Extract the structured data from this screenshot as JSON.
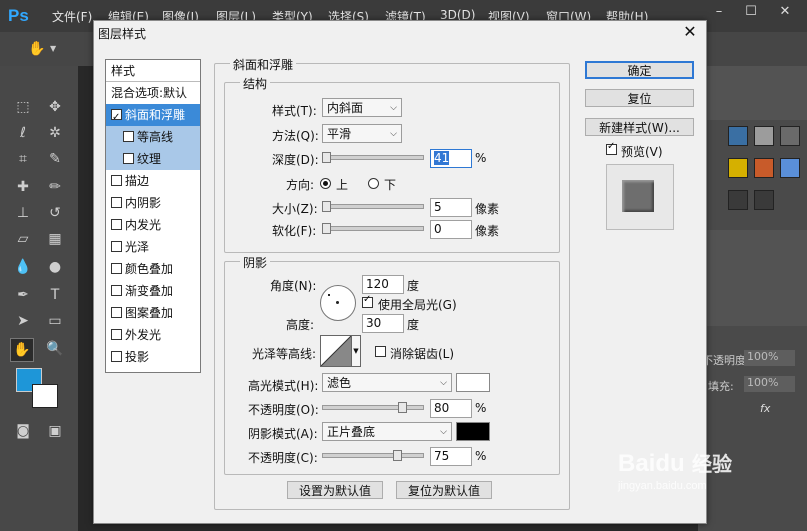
{
  "app": {
    "logo": "Ps",
    "menus": [
      "文件(F)",
      "编辑(E)",
      "图像(I)",
      "图层(L)",
      "类型(Y)",
      "选择(S)",
      "滤镜(T)",
      "3D(D)",
      "视图(V)",
      "窗口(W)",
      "帮助(H)"
    ],
    "right_panel": {
      "opacity_label": "不透明度:",
      "opacity_value": "100%",
      "fill_label": "填充:",
      "fill_value": "100%",
      "fx": "fx"
    }
  },
  "dialog": {
    "title": "图层样式",
    "close": "✕",
    "sidebar": {
      "header": "样式",
      "blend": "混合选项:默认",
      "items": [
        {
          "label": "斜面和浮雕",
          "checked": true,
          "selected": true,
          "sub": false
        },
        {
          "label": "等高线",
          "checked": false,
          "selected": false,
          "sub": true
        },
        {
          "label": "纹理",
          "checked": false,
          "selected": false,
          "sub": true
        },
        {
          "label": "描边",
          "checked": false,
          "selected": false,
          "sub": false
        },
        {
          "label": "内阴影",
          "checked": false,
          "selected": false,
          "sub": false
        },
        {
          "label": "内发光",
          "checked": false,
          "selected": false,
          "sub": false
        },
        {
          "label": "光泽",
          "checked": false,
          "selected": false,
          "sub": false
        },
        {
          "label": "颜色叠加",
          "checked": false,
          "selected": false,
          "sub": false
        },
        {
          "label": "渐变叠加",
          "checked": false,
          "selected": false,
          "sub": false
        },
        {
          "label": "图案叠加",
          "checked": false,
          "selected": false,
          "sub": false
        },
        {
          "label": "外发光",
          "checked": false,
          "selected": false,
          "sub": false
        },
        {
          "label": "投影",
          "checked": false,
          "selected": false,
          "sub": false
        }
      ]
    },
    "bevel": {
      "group_title": "斜面和浮雕",
      "structure_title": "结构",
      "style_label": "样式(T):",
      "style_value": "内斜面",
      "technique_label": "方法(Q):",
      "technique_value": "平滑",
      "depth_label": "深度(D):",
      "depth_value": "41",
      "depth_unit": "%",
      "depth_level": 0.41,
      "direction_label": "方向:",
      "dir_up": "上",
      "dir_down": "下",
      "size_label": "大小(Z):",
      "size_value": "5",
      "size_unit": "像素",
      "soften_label": "软化(F):",
      "soften_value": "0",
      "soften_unit": "像素"
    },
    "shading": {
      "title": "阴影",
      "angle_label": "角度(N):",
      "angle_value": "120",
      "angle_unit": "度",
      "global_light": "使用全局光(G)",
      "altitude_label": "高度:",
      "altitude_value": "30",
      "altitude_unit": "度",
      "gloss_label": "光泽等高线:",
      "antialias": "消除锯齿(L)",
      "highlight_label": "高光模式(H):",
      "highlight_mode": "滤色",
      "highlight_color": "#ffffff",
      "hl_opacity_label": "不透明度(O):",
      "hl_opacity_value": "80",
      "hl_opacity_unit": "%",
      "shadow_label": "阴影模式(A):",
      "shadow_mode": "正片叠底",
      "shadow_color": "#000000",
      "sh_opacity_label": "不透明度(C):",
      "sh_opacity_value": "75",
      "sh_opacity_unit": "%"
    },
    "buttons": {
      "make_default": "设置为默认值",
      "reset_default": "复位为默认值",
      "ok": "确定",
      "reset": "复位",
      "new_style": "新建样式(W)...",
      "preview": "预览(V)"
    }
  },
  "watermark": {
    "brand": "Baidu",
    "suffix": "经验",
    "url": "jingyan.baidu.com"
  }
}
